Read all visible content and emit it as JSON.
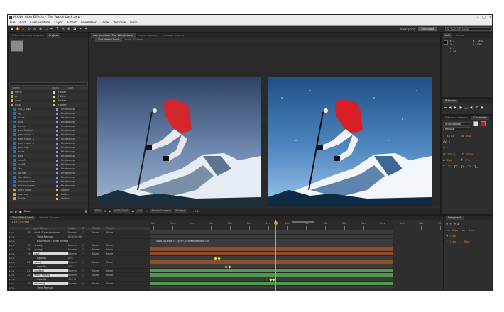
{
  "window": {
    "title": "Adobe After Effects - The Watch back.aep *",
    "controls": [
      "–",
      "□",
      "×"
    ]
  },
  "menu": [
    "File",
    "Edit",
    "Composition",
    "Layer",
    "Effect",
    "Animation",
    "View",
    "Window",
    "Help"
  ],
  "toolbar": {
    "workspace_label": "Workspace:",
    "workspace_value": "Standard",
    "search_placeholder": "Search Help"
  },
  "project": {
    "tabs": [
      "Effect Controls: sky.psd",
      "Project"
    ],
    "columns": [
      "Name",
      "Label",
      "Type"
    ],
    "items": [
      {
        "name": "comp",
        "type": "Folder",
        "icon": "folder",
        "label_color": "#d9d9d9"
      },
      {
        "name": "pic",
        "type": "Folder",
        "icon": "folder",
        "label_color": "#d9d9d9"
      },
      {
        "name": "done",
        "type": "Folder",
        "icon": "folder",
        "label_color": "#e6c23a"
      },
      {
        "name": "man",
        "type": "Folder",
        "icon": "folder",
        "label_color": "#e6c23a"
      },
      {
        "name": "(bg1) logo",
        "type": "Photoshop",
        "icon": "ps",
        "label_color": "#8f8ff0"
      },
      {
        "name": "bg",
        "type": "Photoshop",
        "icon": "ps",
        "label_color": "#8f8ff0"
      },
      {
        "name": "black",
        "type": "Photoshop",
        "icon": "ps",
        "label_color": "#8f8ff0"
      },
      {
        "name": "blue",
        "type": "Photoshop",
        "icon": "ps",
        "label_color": "#8f8ff0"
      },
      {
        "name": "bucket",
        "type": "Photoshop",
        "icon": "ps",
        "label_color": "#8f8ff0"
      },
      {
        "name": "gear bottom",
        "type": "Photoshop",
        "icon": "ps",
        "label_color": "#8f8ff0"
      },
      {
        "name": "gear move 2",
        "type": "Photoshop",
        "icon": "ps",
        "label_color": "#8f8ff0"
      },
      {
        "name": "gear move 3",
        "type": "Photoshop",
        "icon": "ps",
        "label_color": "#8f8ff0"
      },
      {
        "name": "gear move 4",
        "type": "Photoshop",
        "icon": "ps",
        "label_color": "#8f8ff0"
      },
      {
        "name": "gear top",
        "type": "Photoshop",
        "icon": "ps",
        "label_color": "#8f8ff0"
      },
      {
        "name": "more",
        "type": "Photoshop",
        "icon": "ps",
        "label_color": "#8f8ff0"
      },
      {
        "name": "part",
        "type": "Photoshop",
        "icon": "ps",
        "label_color": "#8f8ff0"
      },
      {
        "name": "ropeA",
        "type": "Photoshop",
        "icon": "ps",
        "label_color": "#8f8ff0"
      },
      {
        "name": "ropeB",
        "type": "Photoshop",
        "icon": "ps",
        "label_color": "#8f8ff0"
      },
      {
        "name": "sky",
        "type": "Photoshop",
        "icon": "ps",
        "label_color": "#8f8ff0"
      },
      {
        "name": "spring",
        "type": "Photoshop",
        "icon": "ps",
        "label_color": "#8f8ff0"
      },
      {
        "name": "star & line",
        "type": "Photoshop",
        "icon": "ps",
        "label_color": "#8f8ff0"
      },
      {
        "name": "window close",
        "type": "Photoshop",
        "icon": "ps",
        "label_color": "#8f8ff0"
      },
      {
        "name": "window open",
        "type": "Photoshop",
        "icon": "ps",
        "label_color": "#8f8ff0"
      },
      {
        "name": "open door",
        "type": "Folder",
        "icon": "folder",
        "label_color": "#e6c23a"
      },
      {
        "name": "pool car",
        "type": "Folder",
        "icon": "folder",
        "label_color": "#e6c23a"
      },
      {
        "name": "Solids",
        "type": "Folder",
        "icon": "folder",
        "label_color": "#e6c23a"
      }
    ],
    "bottom": {
      "bpc": "8 bpc"
    }
  },
  "composition": {
    "tabs": [
      "Composition: The Watch back",
      "Layer: (none)",
      "Footage: (none)"
    ],
    "subtabs": [
      "The Watch back",
      "single 02 back"
    ],
    "controls": {
      "zoom": "50%",
      "timecode": "0;00;00;00",
      "resolution": "Full",
      "camera": "Active Camera",
      "views": "2 Views",
      "exposure": "+0.0"
    }
  },
  "info": {
    "tabs": [
      "Info",
      "Audio"
    ],
    "r": "R :",
    "g": "G :",
    "b": "B :",
    "a": "A : 0",
    "x": "X : 1492",
    "y": "Y : 120"
  },
  "preview": {
    "tabs": [
      "Preview"
    ],
    "buttons": [
      "⏮",
      "◀|",
      "▶",
      "|▶",
      "⏭",
      "◀)",
      "⟲",
      "▣"
    ]
  },
  "character": {
    "tabs": [
      "Effects & Presets",
      "Character"
    ],
    "font": "Arial Narrow",
    "style": "Regular",
    "size": "48 px",
    "leading": "Auto",
    "tracking": "0",
    "stroke": "-",
    "vscale": "100 %",
    "hscale": "100 %",
    "baseline": "0 px",
    "tsume": "0 %"
  },
  "paragraph": {
    "tabs": [
      "Paragraph"
    ],
    "indent_left": "0 px",
    "indent_right": "0 px",
    "indent_first": "0 px",
    "space_before": "0 px",
    "space_after": "0 px"
  },
  "timeline": {
    "tabs": [
      "The Watch back",
      "Render Queue"
    ],
    "timecode": "0;00;00;00",
    "columns": [
      "#",
      "Layer Name",
      "Mode",
      "T",
      "TrkMat",
      "Parent"
    ],
    "ruler_labels": [
      "00s",
      "02s",
      "04s",
      "06s",
      "08s",
      "10s",
      "12s",
      "14s",
      "16s",
      "18s",
      "20s",
      "22s",
      "24s",
      "26s",
      "28s",
      "30s"
    ],
    "layers": [
      {
        "num": "16",
        "name": "[ cloth & gear bottom]",
        "mode": "Normal",
        "trkmat": "None",
        "parent": "None",
        "bar": "grey",
        "highlight": false
      },
      {
        "num": "",
        "name": "Time Remap",
        "mode": "",
        "trkmat": "",
        "parent": "",
        "bar": "grey",
        "highlight": false,
        "sub": true,
        "value": "0;00;00;00"
      },
      {
        "num": "",
        "name": "Expression : Time Remap",
        "mode": "",
        "trkmat": "",
        "parent": "",
        "bar": "grey",
        "highlight": false,
        "sub": true,
        "expr": "loopOut(type = \"cycle\", numKeyframes = 0)"
      },
      {
        "num": "17",
        "name": "[ chain]",
        "mode": "Normal",
        "trkmat": "None",
        "parent": "None",
        "bar": "grey",
        "highlight": false
      },
      {
        "num": "18",
        "name": "[ spring]",
        "mode": "Normal",
        "trkmat": "None",
        "parent": "None",
        "bar": "orange",
        "highlight": false
      },
      {
        "num": "19",
        "name": "[ part]",
        "mode": "Normal",
        "trkmat": "None",
        "parent": "None",
        "bar": "orange",
        "highlight": true
      },
      {
        "num": "",
        "name": "Opacity",
        "mode": "",
        "trkmat": "",
        "parent": "",
        "bar": "grey",
        "highlight": false,
        "sub": true,
        "value": "0 %"
      },
      {
        "num": "20",
        "name": "[ gear]",
        "mode": "Normal",
        "trkmat": "None",
        "parent": "None",
        "bar": "orange",
        "highlight": true
      },
      {
        "num": "",
        "name": "Opacity",
        "mode": "",
        "trkmat": "",
        "parent": "",
        "bar": "grey",
        "highlight": false,
        "sub": true,
        "value": "0 %"
      },
      {
        "num": "21",
        "name": "[ bucket]",
        "mode": "Normal",
        "trkmat": "None",
        "parent": "None",
        "bar": "green",
        "highlight": true
      },
      {
        "num": "22",
        "name": "[ more ropeA]",
        "mode": "Normal",
        "trkmat": "None",
        "parent": "None",
        "bar": "green",
        "highlight": true
      },
      {
        "num": "",
        "name": "Opacity",
        "mode": "",
        "trkmat": "",
        "parent": "",
        "bar": "grey",
        "highlight": false,
        "sub": true,
        "value": "100 %"
      },
      {
        "num": "23",
        "name": "[ window]",
        "mode": "Normal",
        "trkmat": "None",
        "parent": "None",
        "bar": "green",
        "highlight": true
      },
      {
        "num": "",
        "name": "Time Remap",
        "mode": "",
        "trkmat": "",
        "parent": "",
        "bar": "grey",
        "highlight": false,
        "sub": true
      },
      {
        "num": "",
        "name": "Expression : Time Remap",
        "mode": "",
        "trkmat": "",
        "parent": "",
        "bar": "grey",
        "highlight": false,
        "sub": true,
        "expr": "loopOut(type = \"cycle\", numKeyframes = 0)"
      }
    ],
    "bottom_label": "Toggle Switches / Modes"
  },
  "colors": {
    "accent": "#e29a2e",
    "panel": "#2e2e2e",
    "green_layer": "#4f9a4f",
    "orange_layer": "#8a4f2a"
  }
}
